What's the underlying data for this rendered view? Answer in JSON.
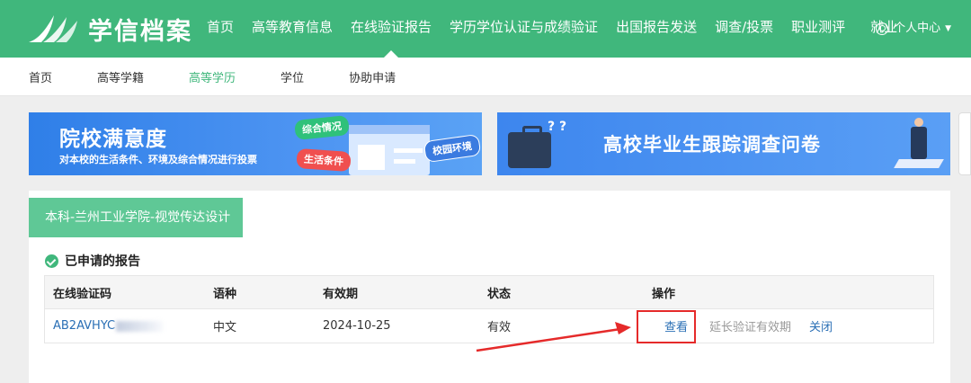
{
  "header": {
    "brand": "学信档案",
    "nav": [
      {
        "label": "首页"
      },
      {
        "label": "高等教育信息"
      },
      {
        "label": "在线验证报告",
        "active": true
      },
      {
        "label": "学历学位认证与成绩验证"
      },
      {
        "label": "出国报告发送"
      },
      {
        "label": "调查/投票"
      },
      {
        "label": "职业测评"
      },
      {
        "label": "就业"
      }
    ],
    "user_label": "个人中心"
  },
  "subnav": [
    {
      "label": "首页"
    },
    {
      "label": "高等学籍"
    },
    {
      "label": "高等学历",
      "active": true
    },
    {
      "label": "学位"
    },
    {
      "label": "协助申请"
    }
  ],
  "banners": {
    "left": {
      "title": "院校满意度",
      "subtitle": "对本校的生活条件、环境及综合情况进行投票",
      "tags": [
        "综合情况",
        "生活条件",
        "校园环境"
      ]
    },
    "right": {
      "title": "高校毕业生跟踪调查问卷",
      "marks": "? ?"
    }
  },
  "card": {
    "school_tab": "本科-兰州工业学院-视觉传达设计",
    "section_title": "已申请的报告",
    "table": {
      "headers": [
        "在线验证码",
        "语种",
        "有效期",
        "状态",
        "操作"
      ],
      "rows": [
        {
          "code": "AB2AVHYC",
          "language": "中文",
          "valid_until": "2024-10-25",
          "status": "有效",
          "actions": {
            "view": "查看",
            "extend": "延长验证有效期",
            "close": "关闭"
          }
        }
      ]
    }
  },
  "colors": {
    "brand_green": "#40b77c",
    "tab_green": "#5fc896",
    "link_blue": "#2a6fb5",
    "annotation_red": "#e52a2a"
  }
}
